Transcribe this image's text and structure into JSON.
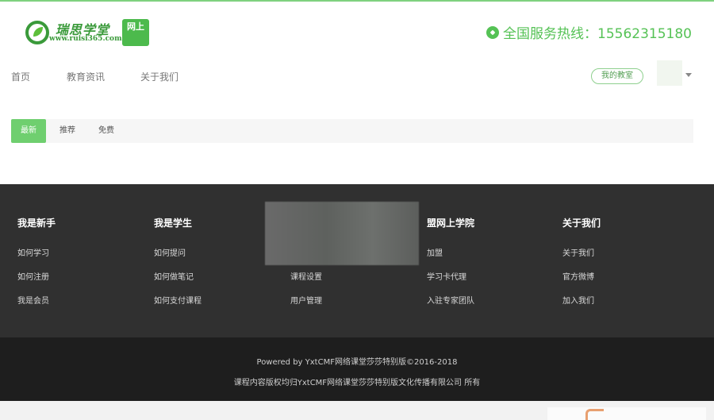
{
  "header": {
    "logo_text": "瑞思学堂",
    "logo_url": "www.ruisi365.com",
    "logo_badge": "网上",
    "hotline": "全国服务热线：15562315180"
  },
  "nav": {
    "items": [
      {
        "label": "首页"
      },
      {
        "label": "教育资讯"
      },
      {
        "label": "关于我们"
      }
    ],
    "classroom_button": "我的教室"
  },
  "tabs": [
    {
      "label": "最新",
      "active": true
    },
    {
      "label": "推荐",
      "active": false
    },
    {
      "label": "免费",
      "active": false
    }
  ],
  "footer": {
    "columns": [
      {
        "title": "我是新手",
        "links": [
          "如何学习",
          "如何注册",
          "我是会员"
        ]
      },
      {
        "title": "我是学生",
        "links": [
          "如何提问",
          "如何做笔记",
          "如何支付课程"
        ]
      },
      {
        "title": "",
        "links": [
          "",
          "课程设置",
          "用户管理"
        ]
      },
      {
        "title": "盟网上学院",
        "links": [
          "加盟",
          "学习卡代理",
          "入驻专家团队"
        ]
      },
      {
        "title": "关于我们",
        "links": [
          "关于我们",
          "官方微博",
          "加入我们"
        ]
      }
    ],
    "powered_by": "Powered by YxtCMF网络课堂莎莎特别版©2016-2018",
    "copyright": "课程内容版权均归YxtCMF网络课堂莎莎特别版文化传播有限公司 所有"
  },
  "colors": {
    "accent": "#55c255",
    "footer_bg": "#303030",
    "copyright_bg": "#1e1e1e"
  }
}
